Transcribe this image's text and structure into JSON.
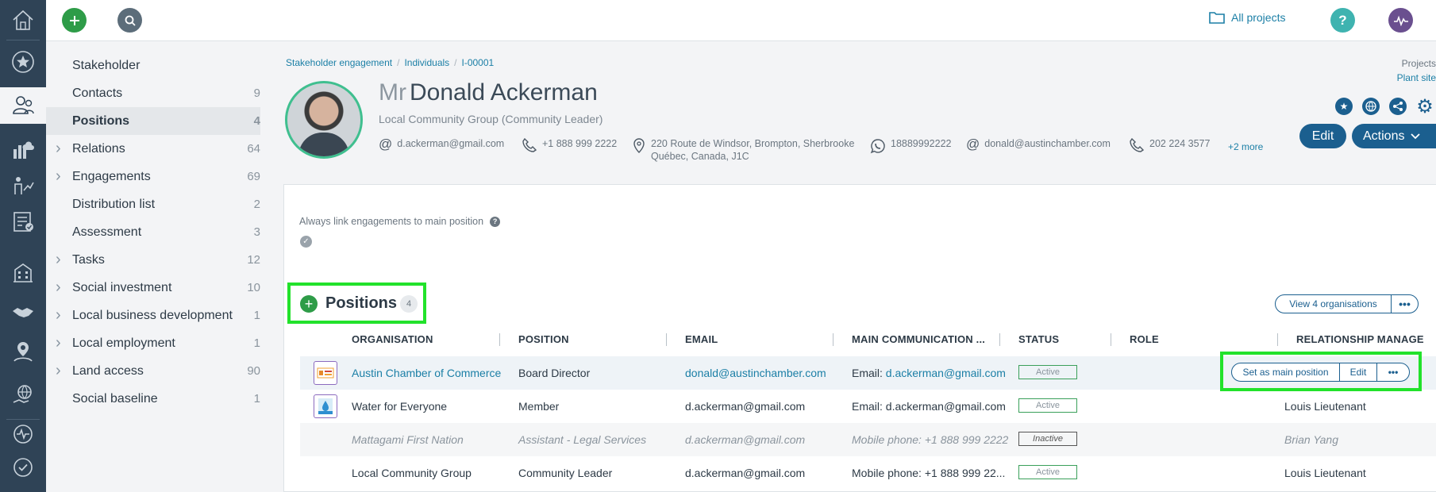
{
  "rail": {
    "icons": [
      "home-icon",
      "star-icon",
      "stakeholders-icon",
      "chart-cloud-icon",
      "growth-icon",
      "checklist-icon",
      "buildings-icon",
      "handshake-icon",
      "person-location-icon",
      "globe-hand-icon",
      "activity-icon",
      "check-icon"
    ]
  },
  "topbar": {
    "all_projects": "All projects",
    "help": "?"
  },
  "subnav": {
    "items": [
      {
        "label": "Stakeholder",
        "count": "",
        "expandable": false
      },
      {
        "label": "Contacts",
        "count": "9",
        "expandable": false
      },
      {
        "label": "Positions",
        "count": "4",
        "expandable": false
      },
      {
        "label": "Relations",
        "count": "64",
        "expandable": true
      },
      {
        "label": "Engagements",
        "count": "69",
        "expandable": true
      },
      {
        "label": "Distribution list",
        "count": "2",
        "expandable": false
      },
      {
        "label": "Assessment",
        "count": "3",
        "expandable": false
      },
      {
        "label": "Tasks",
        "count": "12",
        "expandable": true
      },
      {
        "label": "Social investment",
        "count": "10",
        "expandable": true
      },
      {
        "label": "Local business development",
        "count": "1",
        "expandable": true
      },
      {
        "label": "Local employment",
        "count": "1",
        "expandable": true
      },
      {
        "label": "Land access",
        "count": "90",
        "expandable": true
      },
      {
        "label": "Social baseline",
        "count": "1",
        "expandable": false
      }
    ]
  },
  "breadcrumb": [
    "Stakeholder engagement",
    "Individuals",
    "I-00001"
  ],
  "profile": {
    "salutation": "Mr",
    "name": "Donald Ackerman",
    "subtitle": "Local Community Group (Community Leader)",
    "contacts": {
      "email1": "d.ackerman@gmail.com",
      "phone1": "+1 888 999 2222",
      "address_line1": "220 Route de Windsor, Brompton, Sherbrooke",
      "address_line2": "Québec, Canada, J1C",
      "whatsapp": "18889992222",
      "email2": "donald@austinchamber.com",
      "phone2": "202 224 3577",
      "more": "+2 more"
    }
  },
  "projects": {
    "label": "Projects",
    "site": "Plant site"
  },
  "header_buttons": {
    "edit": "Edit",
    "actions": "Actions"
  },
  "settings": {
    "link_label": "Always link engagements to main position",
    "qmark": "?",
    "link_checked": true
  },
  "positions": {
    "title": "Positions",
    "count": "4",
    "view_orgs": "View 4 organisations",
    "view_more": "•••",
    "columns": [
      "ORGANISATION",
      "POSITION",
      "EMAIL",
      "MAIN COMMUNICATION ...",
      "STATUS",
      "ROLE",
      "RELATIONSHIP MANAGE"
    ],
    "rows": [
      {
        "org": "Austin Chamber of Commerce",
        "position": "Board Director",
        "email": "donald@austinchamber.com",
        "comm_prefix": "Email: ",
        "comm_value": "d.ackerman@gmail.com",
        "status": "Active",
        "manager": "",
        "inactive": false
      },
      {
        "org": "Water for Everyone",
        "position": "Member",
        "email": "d.ackerman@gmail.com",
        "comm_prefix": "Email: ",
        "comm_value": "d.ackerman@gmail.com",
        "status": "Active",
        "manager": "Louis Lieutenant",
        "inactive": false
      },
      {
        "org": "Mattagami First Nation",
        "position": "Assistant - Legal Services",
        "email": "d.ackerman@gmail.com",
        "comm_prefix": "Mobile phone: ",
        "comm_value": "+1 888 999 2222",
        "status": "Inactive",
        "manager": "Brian Yang",
        "inactive": true
      },
      {
        "org": "Local Community Group",
        "position": "Community Leader",
        "email": "d.ackerman@gmail.com",
        "comm_prefix": "Mobile phone: ",
        "comm_value": "+1 888 999 22...",
        "status": "Active",
        "manager": "Louis Lieutenant",
        "inactive": false
      }
    ],
    "row_actions": {
      "set_main": "Set as main position",
      "edit": "Edit",
      "more": "•••"
    }
  },
  "colors": {
    "rail": "#2f4356",
    "accent": "#1b5f8f",
    "link": "#1b7fa6",
    "add_green": "#2e9c48",
    "highlight": "#22e22b"
  }
}
